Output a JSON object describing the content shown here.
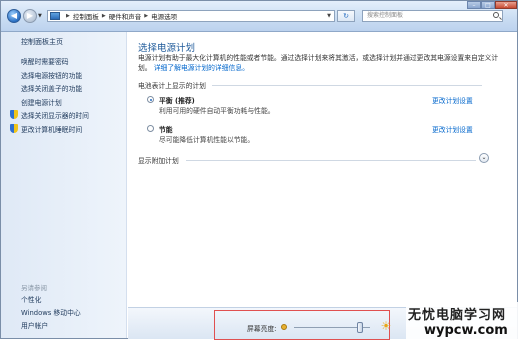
{
  "addressbar": {
    "breadcrumbs": [
      "控制面板",
      "硬件和声音",
      "电源选项"
    ],
    "search_placeholder": "搜索控制面板"
  },
  "sidebar": {
    "home": "控制面板主页",
    "items": [
      {
        "label": "唤醒时需要密码",
        "icon": null
      },
      {
        "label": "选择电源按钮的功能",
        "icon": null
      },
      {
        "label": "选择关闭盖子的功能",
        "icon": null
      },
      {
        "label": "创建电源计划",
        "icon": null
      },
      {
        "label": "选择关闭显示器的时间",
        "icon": "shield-icon"
      },
      {
        "label": "更改计算机睡眠时间",
        "icon": "shield-icon"
      }
    ],
    "see_also": {
      "title": "另请参阅",
      "items": [
        "个性化",
        "Windows 移动中心",
        "用户帐户"
      ]
    }
  },
  "main": {
    "title": "选择电源计划",
    "description_prefix": "电源计划有助于最大化计算机的性能或者节能。通过选择计划来将其激活，或选择计划并通过更改其电源设置来自定义计划。",
    "description_link": "详细了解电源计划的详细信息。",
    "section_title": "电池表计上显示的计划",
    "plans": [
      {
        "name": "平衡 (推荐)",
        "desc": "利用可用的硬件自动平衡功耗与性能。",
        "selected": true,
        "link": "更改计划设置"
      },
      {
        "name": "节能",
        "desc": "尽可能降低计算机性能以节能。",
        "selected": false,
        "link": "更改计划设置"
      }
    ],
    "more_plans": "显示附加计划"
  },
  "footer": {
    "brightness_label": "屏幕亮度:",
    "brightness_level": 0.87
  },
  "watermark": {
    "line1": "无忧电脑学习网",
    "line2": "wypcw.com"
  }
}
